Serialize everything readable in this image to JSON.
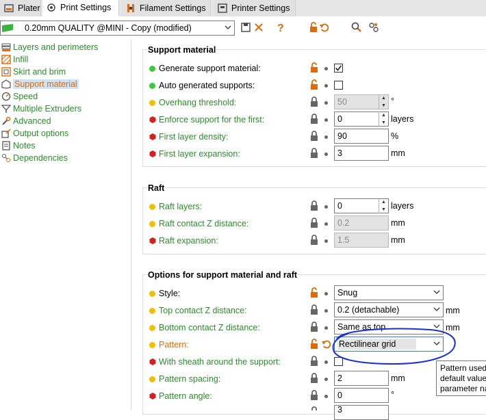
{
  "tabs": [
    {
      "label": "Plater",
      "icon": "plater-icon",
      "active": false
    },
    {
      "label": "Print Settings",
      "icon": "print-settings-icon",
      "active": true
    },
    {
      "label": "Filament Settings",
      "icon": "filament-icon",
      "active": false
    },
    {
      "label": "Printer Settings",
      "icon": "printer-icon",
      "active": false
    }
  ],
  "preset": {
    "label": "0.20mm QUALITY @MINI - Copy (modified)"
  },
  "tree": [
    {
      "label": "Layers and perimeters",
      "icon": "layers-icon"
    },
    {
      "label": "Infill",
      "icon": "infill-icon"
    },
    {
      "label": "Skirt and brim",
      "icon": "skirt-icon"
    },
    {
      "label": "Support material",
      "icon": "support-icon",
      "selected": true
    },
    {
      "label": "Speed",
      "icon": "speed-icon"
    },
    {
      "label": "Multiple Extruders",
      "icon": "extruder-icon"
    },
    {
      "label": "Advanced",
      "icon": "wrench-icon"
    },
    {
      "label": "Output options",
      "icon": "output-icon"
    },
    {
      "label": "Notes",
      "icon": "notes-icon"
    },
    {
      "label": "Dependencies",
      "icon": "dependencies-icon"
    }
  ],
  "groups": {
    "support": {
      "title": "Support material",
      "generate": {
        "label": "Generate support material:",
        "checked": true
      },
      "auto": {
        "label": "Auto generated supports:",
        "checked": false
      },
      "overhang": {
        "label": "Overhang threshold:",
        "value": "50",
        "unit": "°"
      },
      "enforce": {
        "label": "Enforce support for the first:",
        "value": "0",
        "unit": "layers"
      },
      "density": {
        "label": "First layer density:",
        "value": "90",
        "unit": "%"
      },
      "expansion": {
        "label": "First layer expansion:",
        "value": "3",
        "unit": "mm"
      }
    },
    "raft": {
      "title": "Raft",
      "layers": {
        "label": "Raft layers:",
        "value": "0",
        "unit": "layers"
      },
      "contact": {
        "label": "Raft contact Z distance:",
        "value": "0.2",
        "unit": "mm"
      },
      "expansion": {
        "label": "Raft expansion:",
        "value": "1.5",
        "unit": "mm"
      }
    },
    "options": {
      "title": "Options for support material and raft",
      "style": {
        "label": "Style:",
        "value": "Snug"
      },
      "top_contact": {
        "label": "Top contact Z distance:",
        "value": "0.2 (detachable)",
        "unit": "mm"
      },
      "bottom_contact": {
        "label": "Bottom contact Z distance:",
        "value": "Same as top",
        "unit": "mm"
      },
      "pattern": {
        "label": "Pattern:",
        "value": "Rectilinear grid"
      },
      "sheath": {
        "label": "With sheath around the support:"
      },
      "spacing": {
        "label": "Pattern spacing:",
        "value": "2",
        "unit": "mm"
      },
      "angle": {
        "label": "Pattern angle:",
        "value": "0",
        "unit": "°"
      },
      "next_value": "3"
    }
  },
  "tooltip": {
    "line1": "Pattern used",
    "line2": "default value",
    "line3": "parameter na"
  },
  "colors": {
    "accent_orange": "#e06a0a",
    "green": "#2e8b2e",
    "annotation_blue": "#1a2fd0"
  }
}
